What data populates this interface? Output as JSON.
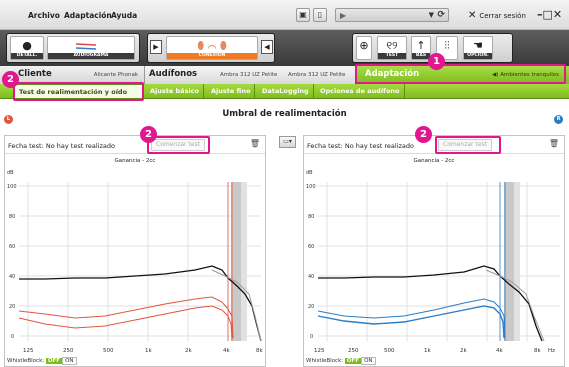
{
  "menu": {
    "archivo": "Archivo",
    "adaptacion": "Adaptación",
    "ayuda": "Ayuda"
  },
  "window": {
    "logout_label": "Cerrar sesión",
    "controls": "–□✕"
  },
  "toolbar": {
    "detail_label": "DETALL.",
    "audiogram_label": "AUDIOGRAMA",
    "connection_label": "CONEXIÓN",
    "test_label": "TEST",
    "bas_label": "BAS",
    "option_label": "OPCION."
  },
  "tabs": {
    "cliente": {
      "title": "Cliente",
      "sub": "Alicante Phonak"
    },
    "audifonos": {
      "title": "Audífonos",
      "sub_left": "Ambra 312 UZ Petite",
      "sub_right": "Ambra 312 UZ Petite"
    },
    "adaptacion": {
      "title": "Adaptación",
      "program": "Ambientes tranquilos"
    }
  },
  "subtabs": [
    {
      "label": "Test de realimentación y oído real",
      "active": true
    },
    {
      "label": "Ajuste básico",
      "active": false
    },
    {
      "label": "Ajuste fino",
      "active": false
    },
    {
      "label": "DataLogging",
      "active": false
    },
    {
      "label": "Opciones de audífono",
      "active": false
    }
  ],
  "content": {
    "title": "Umbral de realimentación",
    "left_dot": "L",
    "right_dot": "R"
  },
  "panels": {
    "left": {
      "fecha": "Fecha test: No hay test realizado",
      "button": "Comenzar test",
      "graph_title": "Ganancia - 2cc",
      "color": "#e2553c"
    },
    "right": {
      "fecha": "Fecha test: No hay test realizado",
      "button": "Comenzar test",
      "graph_title": "Ganancia - 2cc",
      "color": "#2a7dc6"
    }
  },
  "chart_axes": {
    "ylabel": "dB",
    "yticks": [
      "100",
      "80",
      "60",
      "40",
      "20",
      "0"
    ],
    "xticks": [
      "125",
      "250",
      "500",
      "1k",
      "2k",
      "4k",
      "8k",
      "Hz"
    ]
  },
  "whistleblock": {
    "label": "WhistleBlock",
    "off": "OFF",
    "on": "ON"
  },
  "annotations": {
    "badge1": "1",
    "badge2a": "2",
    "badge2b": "2",
    "badge2c": "2"
  },
  "accent": "#7dbb1d",
  "highlight": "#e0178d"
}
